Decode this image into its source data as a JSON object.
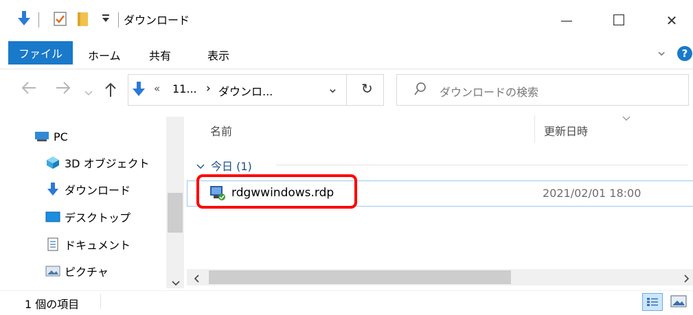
{
  "window": {
    "title": "ダウンロード",
    "minimize_glyph": "—",
    "maximize_glyph": "☐",
    "close_glyph": "✕"
  },
  "ribbon": {
    "tabs": [
      "ファイル",
      "ホーム",
      "共有",
      "表示"
    ],
    "help_glyph": "?",
    "expand_glyph": "⌄"
  },
  "address": {
    "overflow": "«",
    "crumb1": "11...",
    "separator": "›",
    "crumb2": "ダウンロ...",
    "dropdown_glyph": "⌄",
    "refresh_glyph": "↻"
  },
  "search": {
    "placeholder": "ダウンロードの検索"
  },
  "nav_pane": {
    "items": [
      {
        "label": "PC",
        "icon": "pc-icon"
      },
      {
        "label": "3D オブジェクト",
        "icon": "3d-objects-icon"
      },
      {
        "label": "ダウンロード",
        "icon": "download-icon"
      },
      {
        "label": "デスクトップ",
        "icon": "desktop-icon"
      },
      {
        "label": "ドキュメント",
        "icon": "documents-icon"
      },
      {
        "label": "ピクチャ",
        "icon": "pictures-icon"
      }
    ]
  },
  "columns": {
    "name": "名前",
    "date": "更新日時"
  },
  "group": {
    "label": "今日 (1)"
  },
  "files": [
    {
      "name": "rdgwwindows.rdp",
      "modified": "2021/02/01 18:00",
      "icon": "rdp-file-icon"
    }
  ],
  "status": {
    "count": "1 個の項目"
  },
  "colors": {
    "accent": "#1979ca",
    "highlight": "#ff0000",
    "selection_border": "#99c9ef"
  }
}
